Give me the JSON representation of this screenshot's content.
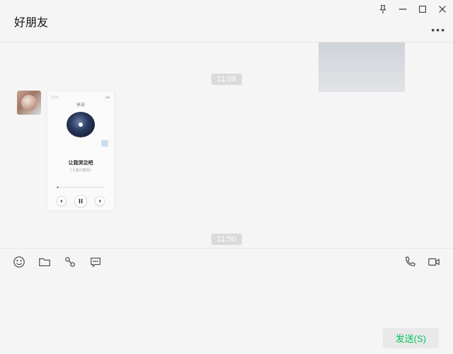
{
  "header": {
    "title": "好朋友"
  },
  "timestamps": {
    "t1": "11:09",
    "t2": "11:50"
  },
  "music": {
    "top_left": "9:24",
    "top_right": "■■",
    "user": "来自",
    "title": "让我哭泣吧",
    "subtitle": "《卡塞尔教授》"
  },
  "send": {
    "label": "发送(S)"
  }
}
